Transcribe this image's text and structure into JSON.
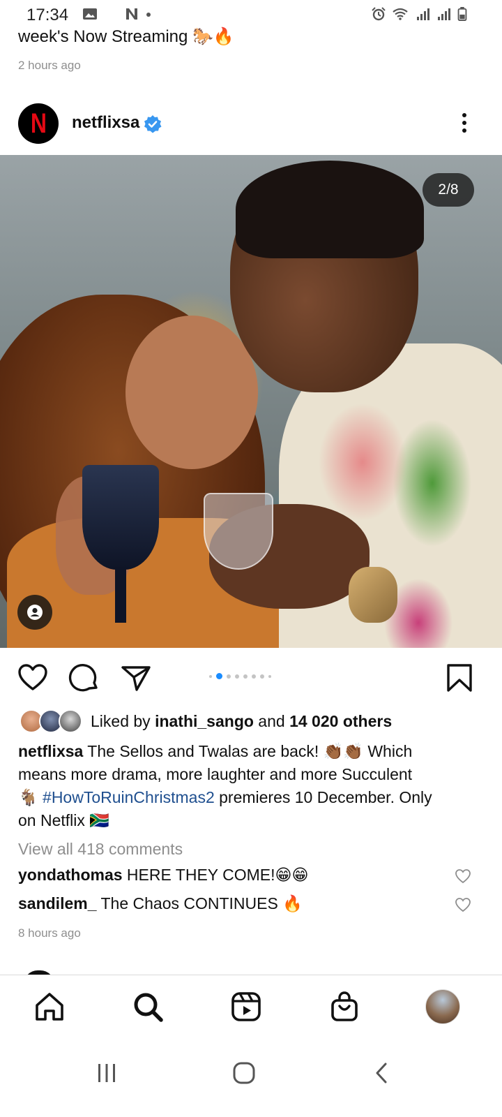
{
  "status_bar": {
    "time": "17:34",
    "left_icons": [
      "image-icon",
      "moon-icon",
      "n-icon",
      "dot-icon"
    ],
    "right_icons": [
      "alarm-icon",
      "wifi-icon",
      "signal-icon",
      "signal-icon-2",
      "battery-icon"
    ]
  },
  "previous_post": {
    "caption_tail": "week's Now Streaming 🐎🔥",
    "timestamp": "2 hours ago"
  },
  "post": {
    "username": "netflixsa",
    "avatar_letter": "N",
    "verified": true,
    "image_counter": "2/8",
    "carousel": {
      "total_dots": 8,
      "active_index": 1
    },
    "likes": {
      "prefix": "Liked by ",
      "liker": "inathi_sango",
      "middle": " and ",
      "others": "14 020 others"
    },
    "caption": {
      "username": "netflixsa",
      "line1": " The Sellos and Twalas are back! 👏🏾👏🏾 Which",
      "line2": "means more drama, more laughter and more Succulent",
      "line3_prefix": "🐐 ",
      "hashtag": "#HowToRuinChristmas2",
      "line3_suffix": " premieres 10 December. Only",
      "line4": "on Netflix 🇿🇦"
    },
    "view_comments": "View all 418 comments",
    "comments": [
      {
        "username": "yondathomas",
        "text": " HERE THEY COME!😁😁"
      },
      {
        "username": "sandilem_",
        "text": " The Chaos CONTINUES 🔥"
      }
    ],
    "timestamp": "8 hours ago"
  },
  "bottom_nav": {
    "items": [
      "home-icon",
      "search-icon",
      "reels-icon",
      "shop-icon",
      "profile-avatar"
    ]
  },
  "system_nav": {
    "items": [
      "recents-button",
      "home-button",
      "back-button"
    ]
  },
  "colors": {
    "accent_blue": "#1a8cff",
    "hashtag": "#1f4f8f",
    "netflix_red": "#e50914",
    "muted_text": "#8e8e8e"
  }
}
